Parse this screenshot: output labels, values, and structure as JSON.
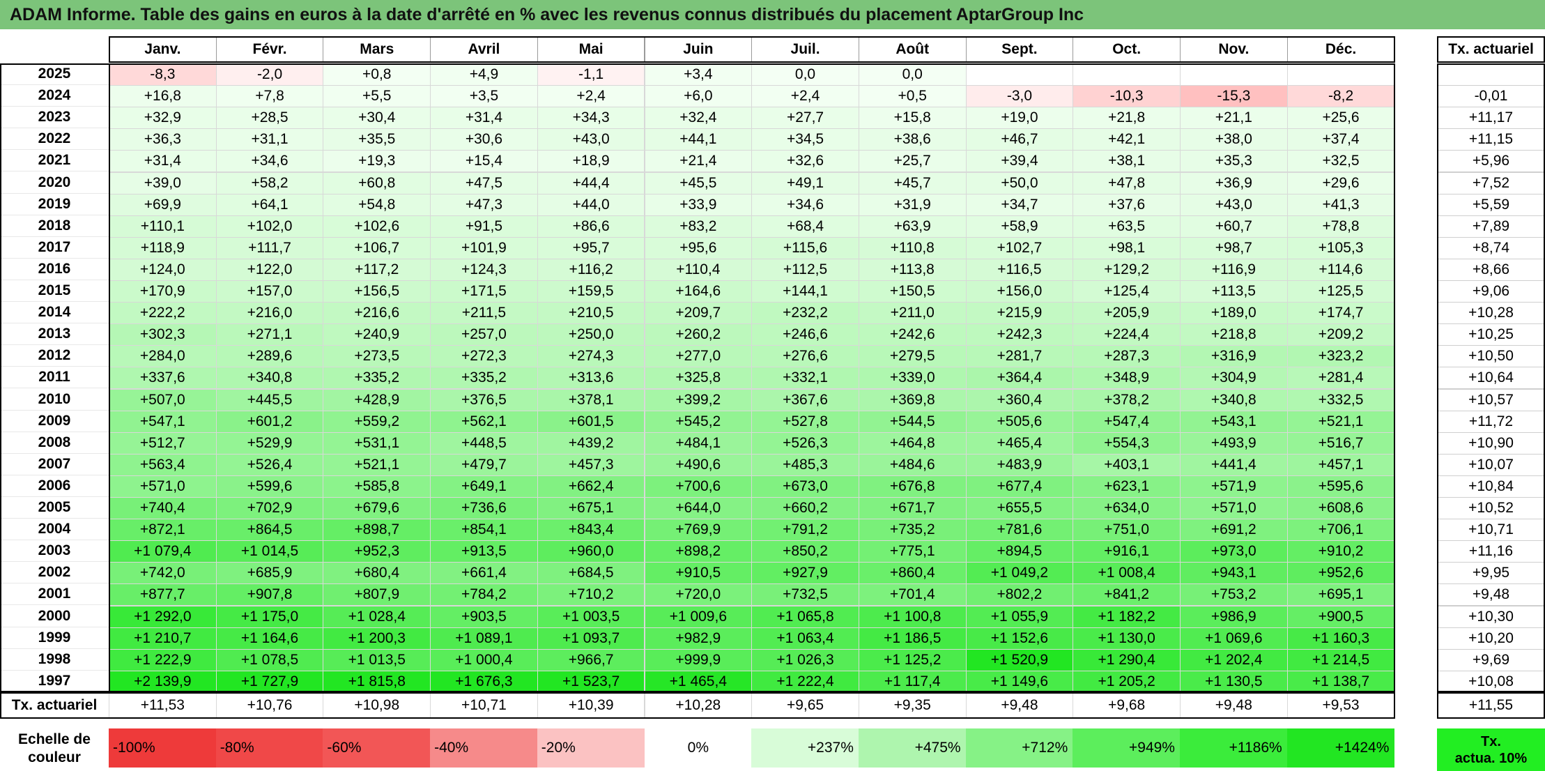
{
  "title": "ADAM Informe. Table des gains en euros à la date d'arrêté en % avec les revenus connus distribués du placement AptarGroup Inc",
  "months": [
    "Janv.",
    "Févr.",
    "Mars",
    "Avril",
    "Mai",
    "Juin",
    "Juil.",
    "Août",
    "Sept.",
    "Oct.",
    "Nov.",
    "Déc."
  ],
  "tx_header": "Tx. actuariel",
  "rows": [
    {
      "year": "2025",
      "vals": [
        "-8,3",
        "-2,0",
        "+0,8",
        "+4,9",
        "-1,1",
        "+3,4",
        "0,0",
        "0,0",
        "",
        "",
        "",
        ""
      ],
      "tx": ""
    },
    {
      "year": "2024",
      "vals": [
        "+16,8",
        "+7,8",
        "+5,5",
        "+3,5",
        "+2,4",
        "+6,0",
        "+2,4",
        "+0,5",
        "-3,0",
        "-10,3",
        "-15,3",
        "-8,2"
      ],
      "tx": "-0,01"
    },
    {
      "year": "2023",
      "vals": [
        "+32,9",
        "+28,5",
        "+30,4",
        "+31,4",
        "+34,3",
        "+32,4",
        "+27,7",
        "+15,8",
        "+19,0",
        "+21,8",
        "+21,1",
        "+25,6"
      ],
      "tx": "+11,17"
    },
    {
      "year": "2022",
      "vals": [
        "+36,3",
        "+31,1",
        "+35,5",
        "+30,6",
        "+43,0",
        "+44,1",
        "+34,5",
        "+38,6",
        "+46,7",
        "+42,1",
        "+38,0",
        "+37,4"
      ],
      "tx": "+11,15"
    },
    {
      "year": "2021",
      "vals": [
        "+31,4",
        "+34,6",
        "+19,3",
        "+15,4",
        "+18,9",
        "+21,4",
        "+32,6",
        "+25,7",
        "+39,4",
        "+38,1",
        "+35,3",
        "+32,5"
      ],
      "tx": "+5,96"
    },
    {
      "year": "2020",
      "vals": [
        "+39,0",
        "+58,2",
        "+60,8",
        "+47,5",
        "+44,4",
        "+45,5",
        "+49,1",
        "+45,7",
        "+50,0",
        "+47,8",
        "+36,9",
        "+29,6"
      ],
      "tx": "+7,52"
    },
    {
      "year": "2019",
      "vals": [
        "+69,9",
        "+64,1",
        "+54,8",
        "+47,3",
        "+44,0",
        "+33,9",
        "+34,6",
        "+31,9",
        "+34,7",
        "+37,6",
        "+43,0",
        "+41,3"
      ],
      "tx": "+5,59"
    },
    {
      "year": "2018",
      "vals": [
        "+110,1",
        "+102,0",
        "+102,6",
        "+91,5",
        "+86,6",
        "+83,2",
        "+68,4",
        "+63,9",
        "+58,9",
        "+63,5",
        "+60,7",
        "+78,8"
      ],
      "tx": "+7,89"
    },
    {
      "year": "2017",
      "vals": [
        "+118,9",
        "+111,7",
        "+106,7",
        "+101,9",
        "+95,7",
        "+95,6",
        "+115,6",
        "+110,8",
        "+102,7",
        "+98,1",
        "+98,7",
        "+105,3"
      ],
      "tx": "+8,74"
    },
    {
      "year": "2016",
      "vals": [
        "+124,0",
        "+122,0",
        "+117,2",
        "+124,3",
        "+116,2",
        "+110,4",
        "+112,5",
        "+113,8",
        "+116,5",
        "+129,2",
        "+116,9",
        "+114,6"
      ],
      "tx": "+8,66"
    },
    {
      "year": "2015",
      "vals": [
        "+170,9",
        "+157,0",
        "+156,5",
        "+171,5",
        "+159,5",
        "+164,6",
        "+144,1",
        "+150,5",
        "+156,0",
        "+125,4",
        "+113,5",
        "+125,5"
      ],
      "tx": "+9,06"
    },
    {
      "year": "2014",
      "vals": [
        "+222,2",
        "+216,0",
        "+216,6",
        "+211,5",
        "+210,5",
        "+209,7",
        "+232,2",
        "+211,0",
        "+215,9",
        "+205,9",
        "+189,0",
        "+174,7"
      ],
      "tx": "+10,28"
    },
    {
      "year": "2013",
      "vals": [
        "+302,3",
        "+271,1",
        "+240,9",
        "+257,0",
        "+250,0",
        "+260,2",
        "+246,6",
        "+242,6",
        "+242,3",
        "+224,4",
        "+218,8",
        "+209,2"
      ],
      "tx": "+10,25"
    },
    {
      "year": "2012",
      "vals": [
        "+284,0",
        "+289,6",
        "+273,5",
        "+272,3",
        "+274,3",
        "+277,0",
        "+276,6",
        "+279,5",
        "+281,7",
        "+287,3",
        "+316,9",
        "+323,2"
      ],
      "tx": "+10,50"
    },
    {
      "year": "2011",
      "vals": [
        "+337,6",
        "+340,8",
        "+335,2",
        "+335,2",
        "+313,6",
        "+325,8",
        "+332,1",
        "+339,0",
        "+364,4",
        "+348,9",
        "+304,9",
        "+281,4"
      ],
      "tx": "+10,64"
    },
    {
      "year": "2010",
      "vals": [
        "+507,0",
        "+445,5",
        "+428,9",
        "+376,5",
        "+378,1",
        "+399,2",
        "+367,6",
        "+369,8",
        "+360,4",
        "+378,2",
        "+340,8",
        "+332,5"
      ],
      "tx": "+10,57"
    },
    {
      "year": "2009",
      "vals": [
        "+547,1",
        "+601,2",
        "+559,2",
        "+562,1",
        "+601,5",
        "+545,2",
        "+527,8",
        "+544,5",
        "+505,6",
        "+547,4",
        "+543,1",
        "+521,1"
      ],
      "tx": "+11,72"
    },
    {
      "year": "2008",
      "vals": [
        "+512,7",
        "+529,9",
        "+531,1",
        "+448,5",
        "+439,2",
        "+484,1",
        "+526,3",
        "+464,8",
        "+465,4",
        "+554,3",
        "+493,9",
        "+516,7"
      ],
      "tx": "+10,90"
    },
    {
      "year": "2007",
      "vals": [
        "+563,4",
        "+526,4",
        "+521,1",
        "+479,7",
        "+457,3",
        "+490,6",
        "+485,3",
        "+484,6",
        "+483,9",
        "+403,1",
        "+441,4",
        "+457,1"
      ],
      "tx": "+10,07"
    },
    {
      "year": "2006",
      "vals": [
        "+571,0",
        "+599,6",
        "+585,8",
        "+649,1",
        "+662,4",
        "+700,6",
        "+673,0",
        "+676,8",
        "+677,4",
        "+623,1",
        "+571,9",
        "+595,6"
      ],
      "tx": "+10,84"
    },
    {
      "year": "2005",
      "vals": [
        "+740,4",
        "+702,9",
        "+679,6",
        "+736,6",
        "+675,1",
        "+644,0",
        "+660,2",
        "+671,7",
        "+655,5",
        "+634,0",
        "+571,0",
        "+608,6"
      ],
      "tx": "+10,52"
    },
    {
      "year": "2004",
      "vals": [
        "+872,1",
        "+864,5",
        "+898,7",
        "+854,1",
        "+843,4",
        "+769,9",
        "+791,2",
        "+735,2",
        "+781,6",
        "+751,0",
        "+691,2",
        "+706,1"
      ],
      "tx": "+10,71"
    },
    {
      "year": "2003",
      "vals": [
        "+1 079,4",
        "+1 014,5",
        "+952,3",
        "+913,5",
        "+960,0",
        "+898,2",
        "+850,2",
        "+775,1",
        "+894,5",
        "+916,1",
        "+973,0",
        "+910,2"
      ],
      "tx": "+11,16"
    },
    {
      "year": "2002",
      "vals": [
        "+742,0",
        "+685,9",
        "+680,4",
        "+661,4",
        "+684,5",
        "+910,5",
        "+927,9",
        "+860,4",
        "+1 049,2",
        "+1 008,4",
        "+943,1",
        "+952,6"
      ],
      "tx": "+9,95"
    },
    {
      "year": "2001",
      "vals": [
        "+877,7",
        "+907,8",
        "+807,9",
        "+784,2",
        "+710,2",
        "+720,0",
        "+732,5",
        "+701,4",
        "+802,2",
        "+841,2",
        "+753,2",
        "+695,1"
      ],
      "tx": "+9,48"
    },
    {
      "year": "2000",
      "vals": [
        "+1 292,0",
        "+1 175,0",
        "+1 028,4",
        "+903,5",
        "+1 003,5",
        "+1 009,6",
        "+1 065,8",
        "+1 100,8",
        "+1 055,9",
        "+1 182,2",
        "+986,9",
        "+900,5"
      ],
      "tx": "+10,30"
    },
    {
      "year": "1999",
      "vals": [
        "+1 210,7",
        "+1 164,6",
        "+1 200,3",
        "+1 089,1",
        "+1 093,7",
        "+982,9",
        "+1 063,4",
        "+1 186,5",
        "+1 152,6",
        "+1 130,0",
        "+1 069,6",
        "+1 160,3"
      ],
      "tx": "+10,20"
    },
    {
      "year": "1998",
      "vals": [
        "+1 222,9",
        "+1 078,5",
        "+1 013,5",
        "+1 000,4",
        "+966,7",
        "+999,9",
        "+1 026,3",
        "+1 125,2",
        "+1 520,9",
        "+1 290,4",
        "+1 202,4",
        "+1 214,5"
      ],
      "tx": "+9,69"
    },
    {
      "year": "1997",
      "vals": [
        "+2 139,9",
        "+1 727,9",
        "+1 815,8",
        "+1 676,3",
        "+1 523,7",
        "+1 465,4",
        "+1 222,4",
        "+1 117,4",
        "+1 149,6",
        "+1 205,2",
        "+1 130,5",
        "+1 138,7"
      ],
      "tx": "+10,08"
    }
  ],
  "footer": {
    "label": "Tx. actuariel",
    "vals": [
      "+11,53",
      "+10,76",
      "+10,98",
      "+10,71",
      "+10,39",
      "+10,28",
      "+9,65",
      "+9,35",
      "+9,48",
      "+9,68",
      "+9,48",
      "+9,53"
    ],
    "tx": "+11,55"
  },
  "scale": {
    "label_line1": "Echelle de",
    "label_line2": "couleur",
    "items": [
      {
        "text": "-100%",
        "color": "#ee3a3a"
      },
      {
        "text": "-80%",
        "color": "#f04848"
      },
      {
        "text": "-60%",
        "color": "#f25656"
      },
      {
        "text": "-40%",
        "color": "#f68a8a"
      },
      {
        "text": "-20%",
        "color": "#fbc2c2"
      },
      {
        "text": "0%",
        "color": "#ffffff"
      },
      {
        "text": "+237%",
        "color": "#d8fcd8"
      },
      {
        "text": "+475%",
        "color": "#aef5ae"
      },
      {
        "text": "+712%",
        "color": "#86f286"
      },
      {
        "text": "+949%",
        "color": "#5cee5c"
      },
      {
        "text": "+1186%",
        "color": "#3bec3b"
      },
      {
        "text": "+1424%",
        "color": "#22e622"
      }
    ],
    "tx_line1": "Tx.",
    "tx_line2": "actua. 10%",
    "tx_color": "#22ee22"
  },
  "colors": {
    "title_bg": "#7cc47a",
    "neg_base": "#ff6b6b",
    "pos_max": "#1ee61e",
    "frame": "#000000"
  }
}
